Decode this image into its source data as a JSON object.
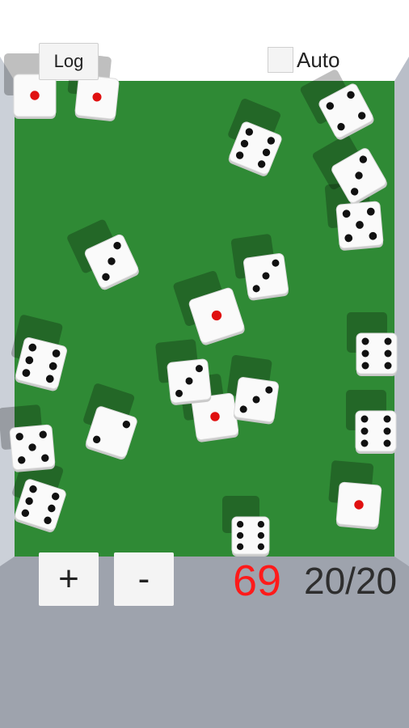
{
  "controls": {
    "log_label": "Log",
    "auto_label": "Auto",
    "auto_checked": false,
    "plus_label": "+",
    "minus_label": "-"
  },
  "score": {
    "total": "69",
    "dice_count": "20/20",
    "total_color": "#ff1a1a"
  },
  "colors": {
    "table": "#2f8a35",
    "pip": "#111111",
    "ace_pip": "#e01010",
    "die_face": "#fafafa"
  },
  "dice": [
    {
      "value": 1
    },
    {
      "value": 1
    },
    {
      "value": 4
    },
    {
      "value": 6
    },
    {
      "value": 3
    },
    {
      "value": 5
    },
    {
      "value": 3
    },
    {
      "value": 3
    },
    {
      "value": 1
    },
    {
      "value": 6
    },
    {
      "value": 6
    },
    {
      "value": 6
    },
    {
      "value": 1
    },
    {
      "value": 3
    },
    {
      "value": 2
    },
    {
      "value": 3
    },
    {
      "value": 6
    },
    {
      "value": 5
    },
    {
      "value": 1
    },
    {
      "value": 6
    }
  ]
}
